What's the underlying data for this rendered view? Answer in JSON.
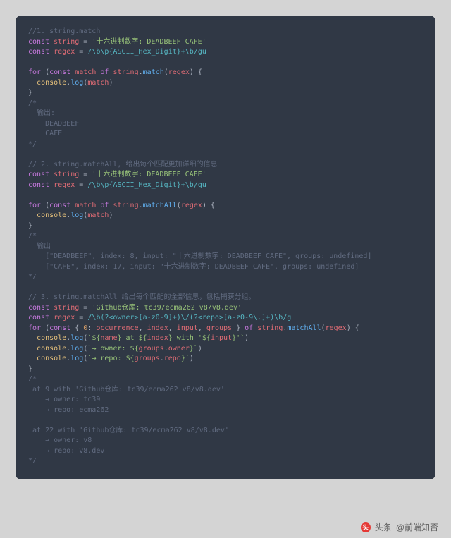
{
  "code": {
    "section1": {
      "comment_title": "//1. string.match",
      "decl_const": "const",
      "ident_string": "string",
      "eq": " = ",
      "string_literal": "'十六进制数字: DEADBEEF CAFE'",
      "ident_regex": "regex",
      "regex_literal": "/\\b\\p{ASCII_Hex_Digit}+\\b/gu",
      "for_kw": "for",
      "paren_open": " (",
      "const_kw2": "const",
      "ident_match": "match",
      "of_kw": "of",
      "call_match_obj": "string",
      "call_match_fn": "match",
      "call_match_arg": "regex",
      "brace_open": ") {",
      "console": "console",
      "log": "log",
      "log_arg": "match",
      "brace_close": "}",
      "output_block": "/*\n  输出:\n    DEADBEEF\n    CAFE\n*/"
    },
    "section2": {
      "comment_title": "// 2. string.matchAll, 给出每个匹配更加详细的信息",
      "string_literal": "'十六进制数字: DEADBEEF CAFE'",
      "regex_literal": "/\\b\\p{ASCII_Hex_Digit}+\\b/gu",
      "call_fn": "matchAll",
      "output_block": "/*\n  输出\n    [\"DEADBEEF\", index: 8, input: \"十六进制数字: DEADBEEF CAFE\", groups: undefined]\n    [\"CAFE\", index: 17, input: \"十六进制数字: DEADBEEF CAFE\", groups: undefined]\n*/"
    },
    "section3": {
      "comment_title": "// 3. string.matchAll 给出每个匹配的全部信息，包括捕获分组。",
      "string_literal": "'Github仓库: tc39/ecma262 v8/v8.dev'",
      "regex_literal": "/\\b(?<owner>[a-z0-9]+)\\/(?<repo>[a-z0-9\\.]+)\\b/g",
      "destruct_num": "0",
      "destruct_occ": "occurrence",
      "destruct_index": "index",
      "destruct_input": "input",
      "destruct_groups": "groups",
      "tmpl1_a": "`${",
      "tmpl1_name": "name",
      "tmpl1_b": "} at ${",
      "tmpl1_index": "index",
      "tmpl1_c": "} with '${",
      "tmpl1_input": "input",
      "tmpl1_d": "}'`",
      "tmpl2_a": "`→ owner: ${",
      "tmpl2_owner": "groups",
      "tmpl2_ownerprop": "owner",
      "tmpl2_b": "}`",
      "tmpl3_a": "`→ repo: ${",
      "tmpl3_repo": "groups",
      "tmpl3_repoprop": "repo",
      "tmpl3_b": "}`",
      "output_block": "/*\n at 9 with 'Github仓库: tc39/ecma262 v8/v8.dev'\n    → owner: tc39\n    → repo: ecma262\n\n at 22 with 'Github仓库: tc39/ecma262 v8/v8.dev'\n    → owner: v8\n    → repo: v8.dev\n*/"
    }
  },
  "watermark": {
    "source_label": "头条",
    "author": "@前端知否"
  }
}
